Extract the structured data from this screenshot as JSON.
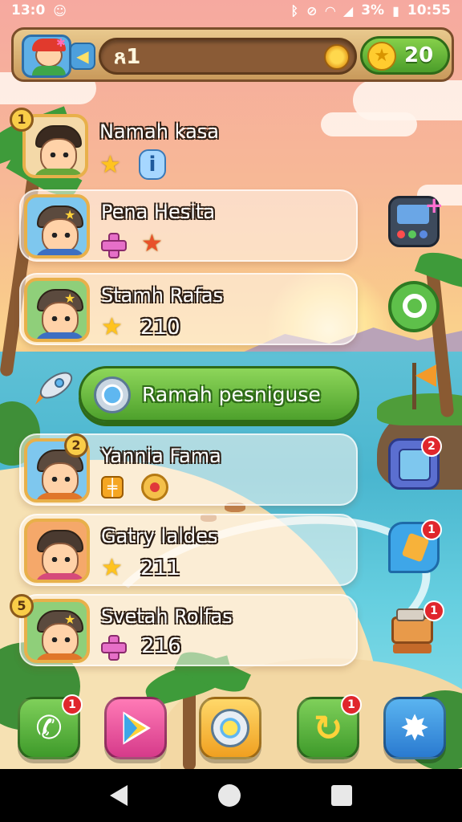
{
  "status_bar": {
    "time_left": "13:0",
    "battery": "3%",
    "clock": "10:55"
  },
  "hud": {
    "level": "ጸ1",
    "coins": "20"
  },
  "friends": [
    {
      "name": "Namah kasa",
      "rank": "1",
      "score": ""
    },
    {
      "name": "Pena Hesita",
      "rank": "",
      "score": ""
    },
    {
      "name": "Stamh Rafas",
      "rank": "",
      "score": "210"
    },
    {
      "name": "Yannia Fama",
      "rank": "2",
      "score": ""
    },
    {
      "name": "Gatry Ialdes",
      "rank": "",
      "score": "211"
    },
    {
      "name": "Svetah Rolfas",
      "rank": "5",
      "score": "216"
    }
  ],
  "cta": {
    "label": "Ramah pesniguse"
  },
  "side_badges": {
    "map": "2",
    "chat": "1",
    "shop": "1"
  },
  "dock_badges": {
    "phone": "1",
    "refresh": "1"
  },
  "colors": {
    "accent_green": "#4ea12c",
    "gold": "#ffc31f",
    "badge_red": "#e0262c"
  }
}
